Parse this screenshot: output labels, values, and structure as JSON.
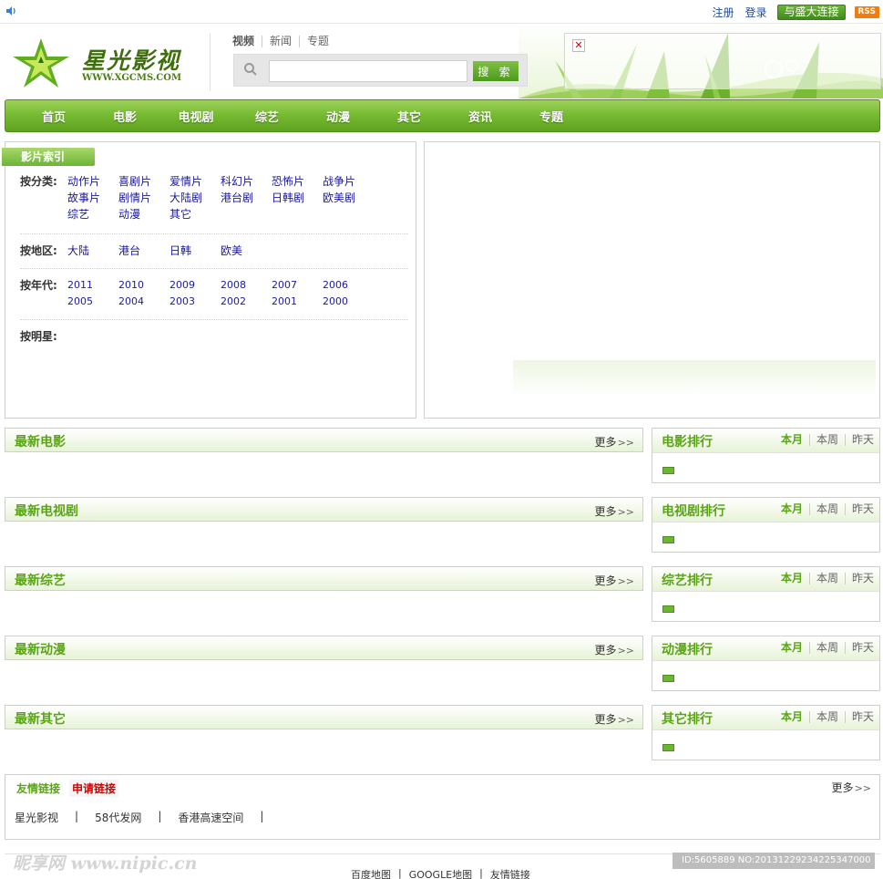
{
  "top": {
    "register": "注册",
    "login": "登录",
    "connect_btn": "与盛大连接",
    "rss": "RSS"
  },
  "logo": {
    "title": "星光影视",
    "url": "WWW.XGCMS.COM"
  },
  "search": {
    "tabs": [
      "视频",
      "新闻",
      "专题"
    ],
    "button": "搜 索",
    "placeholder": ""
  },
  "nav": [
    "首页",
    "电影",
    "电视剧",
    "综艺",
    "动漫",
    "其它",
    "资讯",
    "专题"
  ],
  "index": {
    "title": "影片索引",
    "by_category": {
      "label": "按分类:",
      "items": [
        "动作片",
        "喜剧片",
        "爱情片",
        "科幻片",
        "恐怖片",
        "战争片",
        "故事片",
        "剧情片",
        "大陆剧",
        "港台剧",
        "日韩剧",
        "欧美剧",
        "综艺",
        "动漫",
        "其它"
      ]
    },
    "by_region": {
      "label": "按地区:",
      "items": [
        "大陆",
        "港台",
        "日韩",
        "欧美"
      ]
    },
    "by_year": {
      "label": "按年代:",
      "items": [
        "2011",
        "2010",
        "2009",
        "2008",
        "2007",
        "2006",
        "2005",
        "2004",
        "2003",
        "2002",
        "2001",
        "2000"
      ]
    },
    "by_star": {
      "label": "按明星:"
    }
  },
  "sections": [
    {
      "title": "最新电影",
      "more": "更多",
      "rank_title": "电影排行"
    },
    {
      "title": "最新电视剧",
      "more": "更多",
      "rank_title": "电视剧排行"
    },
    {
      "title": "最新综艺",
      "more": "更多",
      "rank_title": "综艺排行"
    },
    {
      "title": "最新动漫",
      "more": "更多",
      "rank_title": "动漫排行"
    },
    {
      "title": "最新其它",
      "more": "更多",
      "rank_title": "其它排行"
    }
  ],
  "rank_tabs": [
    "本月",
    "本周",
    "昨天"
  ],
  "friends": {
    "title": "友情链接",
    "apply": "申请链接",
    "more": "更多",
    "links": [
      "星光影视",
      "58代发网",
      "香港高速空间"
    ]
  },
  "footer": {
    "links": [
      "百度地图",
      "GOOGLE地图",
      "友情链接"
    ]
  },
  "watermark": {
    "text": "昵享网 www.nipic.cn",
    "id": "ID:5605889 NO:20131229234225347000"
  },
  "colors": {
    "brand_green": "#5aa516",
    "nav_green": "#78bb33",
    "link_blue": "#1b1a9d",
    "apply_red": "#d40000"
  }
}
